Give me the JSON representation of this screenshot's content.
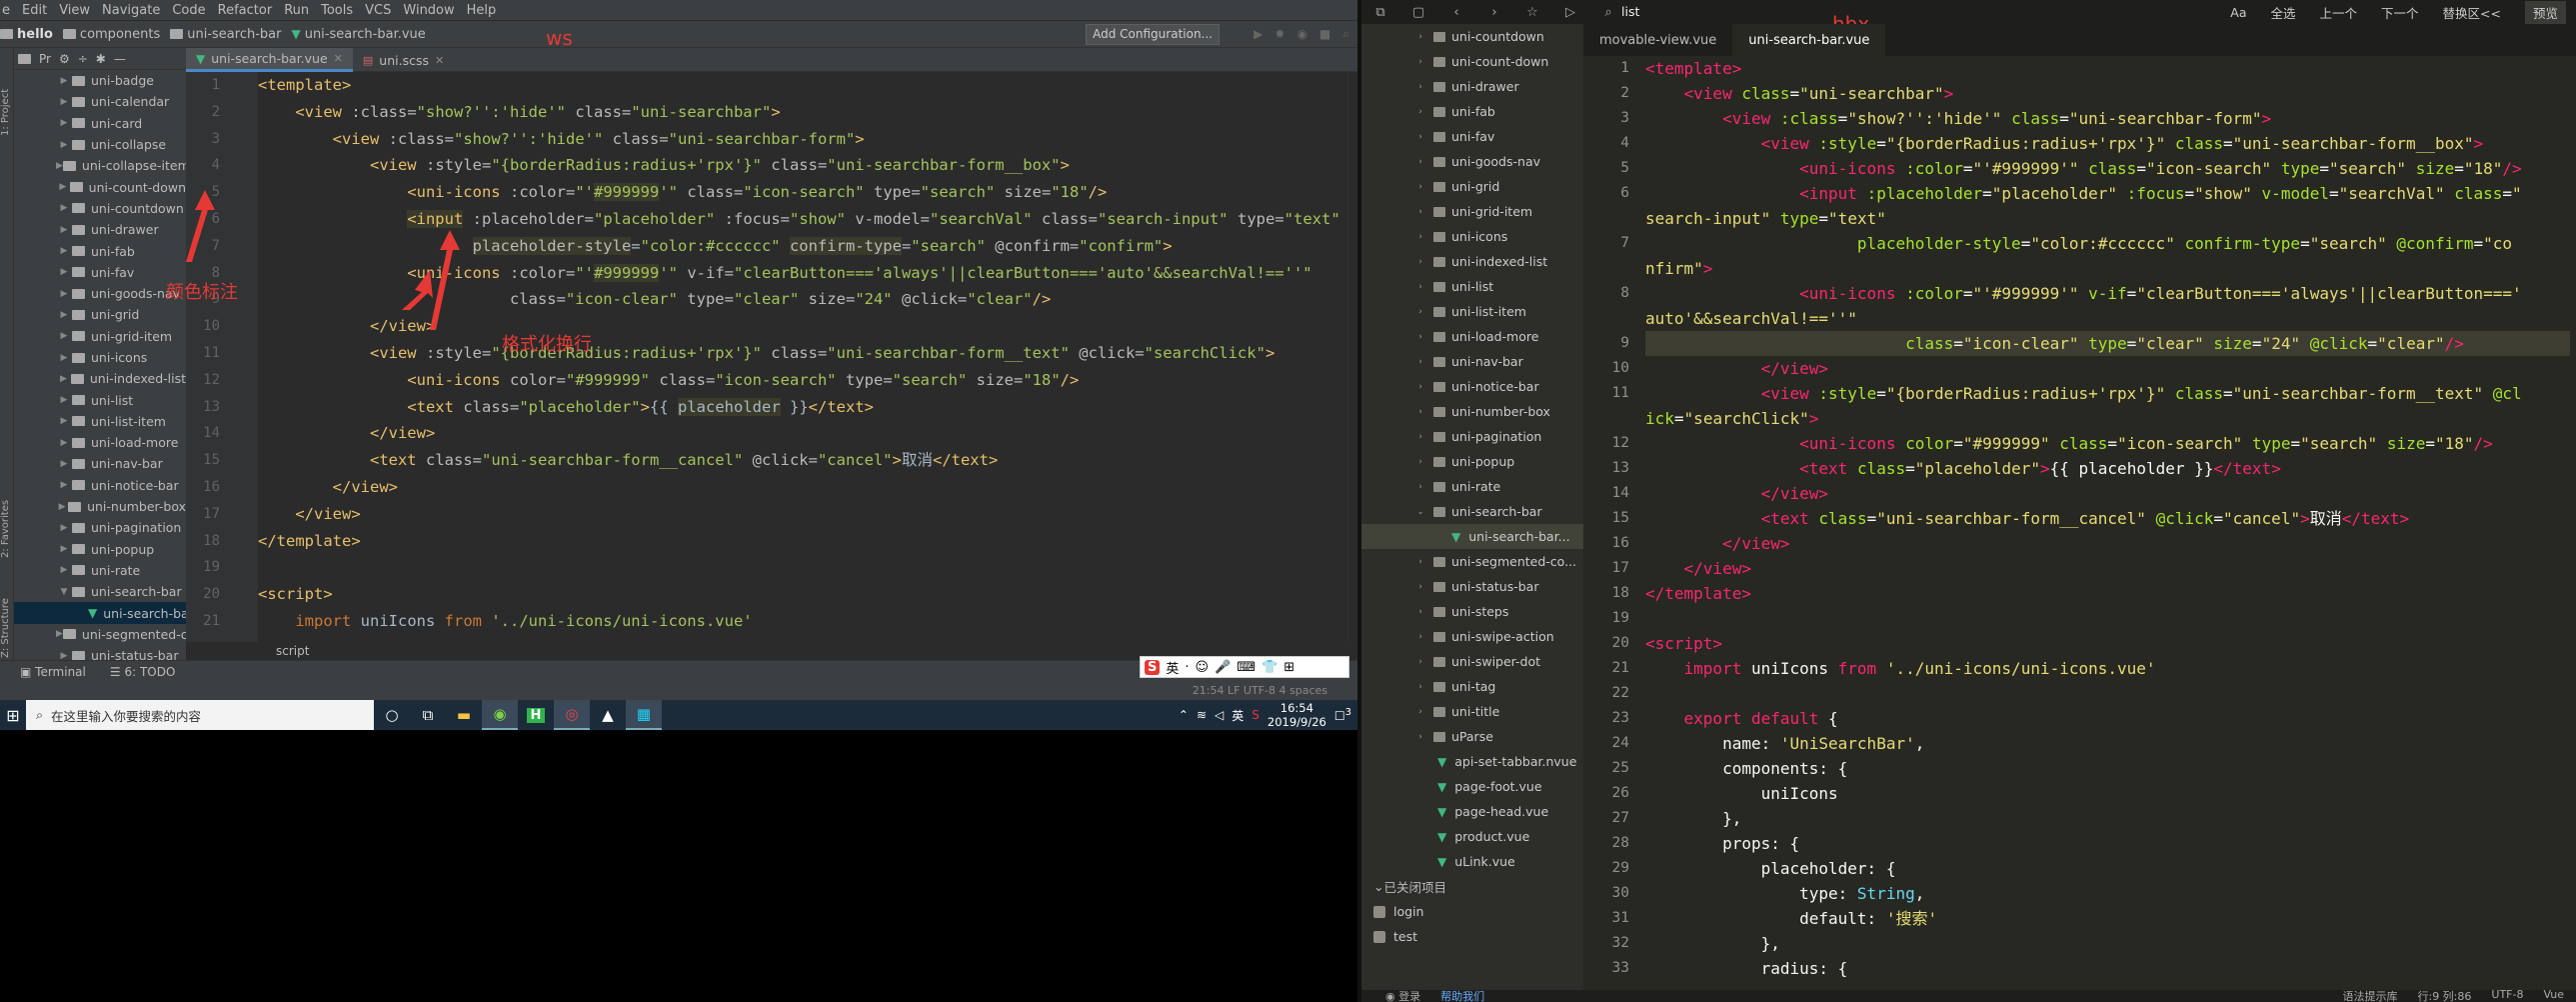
{
  "ide": {
    "menu": [
      "e",
      "Edit",
      "View",
      "Navigate",
      "Code",
      "Refactor",
      "Run",
      "Tools",
      "VCS",
      "Window",
      "Help"
    ],
    "breadcrumb": [
      "hello",
      "components",
      "uni-search-bar",
      "uni-search-bar.vue"
    ],
    "add_config": "Add Configuration...",
    "annotation_ws": "ws",
    "project_label": "Pr",
    "tabs": [
      {
        "label": "uni-search-bar.vue",
        "active": true
      },
      {
        "label": "uni.scss",
        "active": false
      }
    ],
    "tree": [
      {
        "label": "uni-badge",
        "type": "folder"
      },
      {
        "label": "uni-calendar",
        "type": "folder"
      },
      {
        "label": "uni-card",
        "type": "folder"
      },
      {
        "label": "uni-collapse",
        "type": "folder"
      },
      {
        "label": "uni-collapse-item",
        "type": "folder"
      },
      {
        "label": "uni-count-down",
        "type": "folder"
      },
      {
        "label": "uni-countdown",
        "type": "folder"
      },
      {
        "label": "uni-drawer",
        "type": "folder"
      },
      {
        "label": "uni-fab",
        "type": "folder"
      },
      {
        "label": "uni-fav",
        "type": "folder"
      },
      {
        "label": "uni-goods-nav",
        "type": "folder"
      },
      {
        "label": "uni-grid",
        "type": "folder"
      },
      {
        "label": "uni-grid-item",
        "type": "folder"
      },
      {
        "label": "uni-icons",
        "type": "folder"
      },
      {
        "label": "uni-indexed-list",
        "type": "folder"
      },
      {
        "label": "uni-list",
        "type": "folder"
      },
      {
        "label": "uni-list-item",
        "type": "folder"
      },
      {
        "label": "uni-load-more",
        "type": "folder"
      },
      {
        "label": "uni-nav-bar",
        "type": "folder"
      },
      {
        "label": "uni-notice-bar",
        "type": "folder"
      },
      {
        "label": "uni-number-box",
        "type": "folder"
      },
      {
        "label": "uni-pagination",
        "type": "folder"
      },
      {
        "label": "uni-popup",
        "type": "folder"
      },
      {
        "label": "uni-rate",
        "type": "folder"
      },
      {
        "label": "uni-search-bar",
        "type": "folder-open"
      },
      {
        "label": "uni-search-ba",
        "type": "file"
      },
      {
        "label": "uni-segmented-c",
        "type": "folder"
      },
      {
        "label": "uni-status-bar",
        "type": "folder"
      }
    ],
    "line_numbers": [
      "1",
      "2",
      "3",
      "4",
      "5",
      "6",
      "7",
      "8",
      "9",
      "10",
      "11",
      "12",
      "13",
      "14",
      "15",
      "16",
      "17",
      "18",
      "19",
      "20",
      "21"
    ],
    "annotation_color": "颜色标注",
    "annotation_format": "格式化换行",
    "code_crumb": "script",
    "bottom_tabs": [
      "Terminal",
      "6: TODO"
    ],
    "status_text": "21:54   LF   UTF-8   4 spaces",
    "ime": [
      "英",
      "·",
      "☺",
      "🎤",
      "⌨",
      "👕",
      "⊞"
    ],
    "side_tabs": [
      "1: Project",
      "2: Favorites",
      "Z: Structure"
    ]
  },
  "taskbar": {
    "search_placeholder": "在这里输入你要搜索的内容",
    "tray_lang": "英",
    "time": "16:54",
    "date": "2019/9/26",
    "notif_count": "3"
  },
  "hbx": {
    "search_text": "list",
    "tools": [
      "Aa",
      "全选",
      "上一个",
      "下一个",
      "替换区<<",
      "预览"
    ],
    "annotation": "hbx",
    "tabs": [
      {
        "label": "movable-view.vue",
        "active": false
      },
      {
        "label": "uni-search-bar.vue",
        "active": true
      }
    ],
    "tree": [
      {
        "label": "uni-countdown",
        "type": "folder"
      },
      {
        "label": "uni-count-down",
        "type": "folder"
      },
      {
        "label": "uni-drawer",
        "type": "folder"
      },
      {
        "label": "uni-fab",
        "type": "folder"
      },
      {
        "label": "uni-fav",
        "type": "folder"
      },
      {
        "label": "uni-goods-nav",
        "type": "folder"
      },
      {
        "label": "uni-grid",
        "type": "folder"
      },
      {
        "label": "uni-grid-item",
        "type": "folder"
      },
      {
        "label": "uni-icons",
        "type": "folder"
      },
      {
        "label": "uni-indexed-list",
        "type": "folder"
      },
      {
        "label": "uni-list",
        "type": "folder"
      },
      {
        "label": "uni-list-item",
        "type": "folder"
      },
      {
        "label": "uni-load-more",
        "type": "folder"
      },
      {
        "label": "uni-nav-bar",
        "type": "folder"
      },
      {
        "label": "uni-notice-bar",
        "type": "folder"
      },
      {
        "label": "uni-number-box",
        "type": "folder"
      },
      {
        "label": "uni-pagination",
        "type": "folder"
      },
      {
        "label": "uni-popup",
        "type": "folder"
      },
      {
        "label": "uni-rate",
        "type": "folder"
      },
      {
        "label": "uni-search-bar",
        "type": "folder-open"
      },
      {
        "label": "uni-search-bar...",
        "type": "file-sel"
      },
      {
        "label": "uni-segmented-co...",
        "type": "folder"
      },
      {
        "label": "uni-status-bar",
        "type": "folder"
      },
      {
        "label": "uni-steps",
        "type": "folder"
      },
      {
        "label": "uni-swipe-action",
        "type": "folder"
      },
      {
        "label": "uni-swiper-dot",
        "type": "folder"
      },
      {
        "label": "uni-tag",
        "type": "folder"
      },
      {
        "label": "uni-title",
        "type": "folder"
      },
      {
        "label": "uParse",
        "type": "folder"
      },
      {
        "label": "api-set-tabbar.nvue",
        "type": "file"
      },
      {
        "label": "page-foot.vue",
        "type": "file"
      },
      {
        "label": "page-head.vue",
        "type": "file"
      },
      {
        "label": "product.vue",
        "type": "file"
      },
      {
        "label": "uLink.vue",
        "type": "file"
      }
    ],
    "closed_projects_label": "已关闭项目",
    "closed_projects": [
      "login",
      "test"
    ],
    "line_numbers": [
      "1",
      "2",
      "3",
      "4",
      "5",
      "6",
      "",
      "7",
      "",
      "8",
      "",
      "9",
      "10",
      "11",
      "",
      "12",
      "13",
      "14",
      "15",
      "16",
      "17",
      "18",
      "19",
      "20",
      "21",
      "22",
      "23",
      "24",
      "25",
      "26",
      "27",
      "28",
      "29",
      "30",
      "31",
      "32",
      "33"
    ],
    "status_login": "登录",
    "status_help": "帮助我们",
    "status_right": [
      "语法提示库",
      "行:9 列:86",
      "UTF-8",
      "Vue"
    ]
  }
}
